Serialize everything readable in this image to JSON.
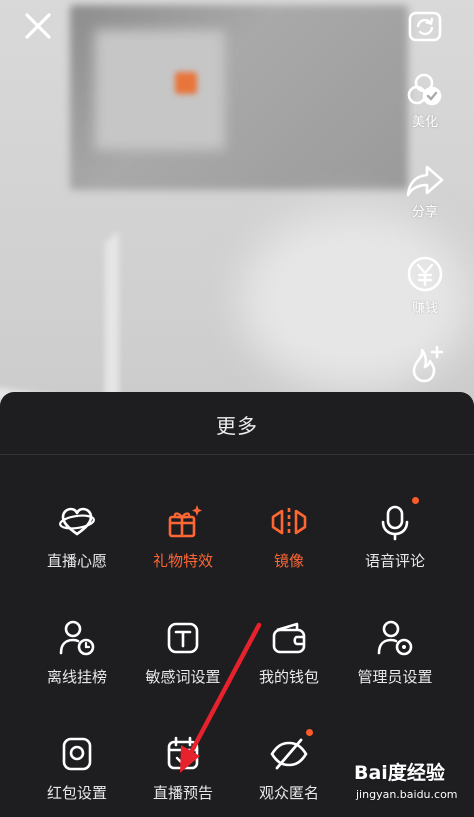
{
  "side": {
    "beautify_label": "美化",
    "share_label": "分享",
    "earn_label": "赚钱"
  },
  "sheet": {
    "title": "更多",
    "rows": [
      [
        {
          "label": "直播心愿",
          "icon": "heart-wish-icon",
          "accent": false,
          "dot": false
        },
        {
          "label": "礼物特效",
          "icon": "gift-sparkle-icon",
          "accent": true,
          "dot": false
        },
        {
          "label": "镜像",
          "icon": "mirror-icon",
          "accent": true,
          "dot": false
        },
        {
          "label": "语音评论",
          "icon": "microphone-icon",
          "accent": false,
          "dot": true
        }
      ],
      [
        {
          "label": "离线挂榜",
          "icon": "user-clock-icon",
          "accent": false,
          "dot": false
        },
        {
          "label": "敏感词设置",
          "icon": "text-box-icon",
          "accent": false,
          "dot": false
        },
        {
          "label": "我的钱包",
          "icon": "wallet-icon",
          "accent": false,
          "dot": false
        },
        {
          "label": "管理员设置",
          "icon": "user-gear-icon",
          "accent": false,
          "dot": false
        }
      ],
      [
        {
          "label": "红包设置",
          "icon": "red-packet-icon",
          "accent": false,
          "dot": false
        },
        {
          "label": "直播预告",
          "icon": "calendar-icon",
          "accent": false,
          "dot": false
        },
        {
          "label": "观众匿名",
          "icon": "eye-off-icon",
          "accent": false,
          "dot": true
        }
      ]
    ]
  },
  "watermark": {
    "logo": "Bai度经验",
    "url": "jingyan.baidu.com"
  },
  "colors": {
    "accent": "#fe6634",
    "sheet_bg": "#1e1e21",
    "annotation_arrow": "#e8222c"
  }
}
